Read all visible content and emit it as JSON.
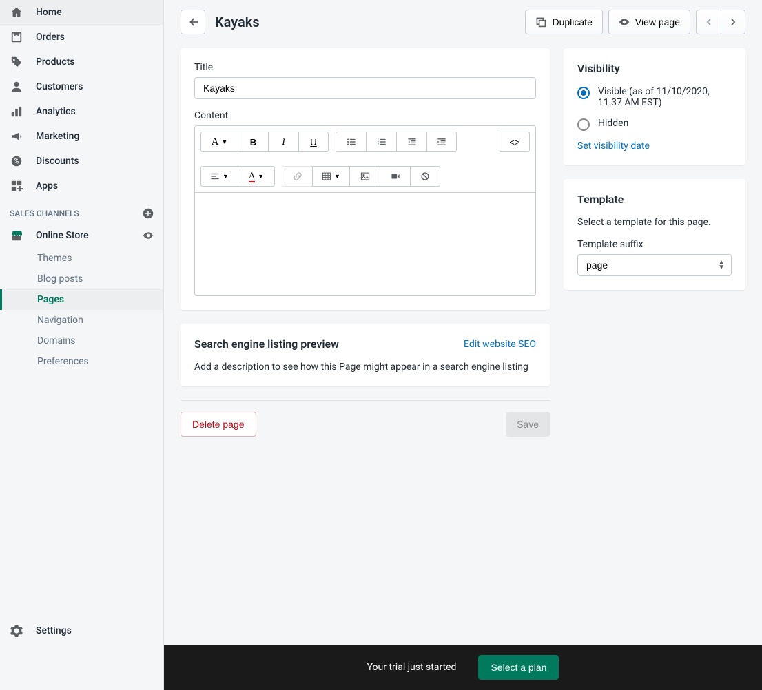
{
  "sidebar": {
    "nav": [
      {
        "label": "Home",
        "icon": "home"
      },
      {
        "label": "Orders",
        "icon": "orders"
      },
      {
        "label": "Products",
        "icon": "tag"
      },
      {
        "label": "Customers",
        "icon": "person"
      },
      {
        "label": "Analytics",
        "icon": "analytics"
      },
      {
        "label": "Marketing",
        "icon": "megaphone"
      },
      {
        "label": "Discounts",
        "icon": "discount"
      },
      {
        "label": "Apps",
        "icon": "apps"
      }
    ],
    "section_label": "SALES CHANNELS",
    "channel": {
      "label": "Online Store"
    },
    "sub_items": [
      "Themes",
      "Blog posts",
      "Pages",
      "Navigation",
      "Domains",
      "Preferences"
    ],
    "settings_label": "Settings"
  },
  "header": {
    "title": "Kayaks",
    "duplicate_label": "Duplicate",
    "view_label": "View page"
  },
  "form": {
    "title_label": "Title",
    "title_value": "Kayaks",
    "content_label": "Content"
  },
  "seo": {
    "heading": "Search engine listing preview",
    "edit_link": "Edit website SEO",
    "description": "Add a description to see how this Page might appear in a search engine listing"
  },
  "visibility": {
    "heading": "Visibility",
    "visible_label": "Visible (as of 11/10/2020, 11:37 AM EST)",
    "hidden_label": "Hidden",
    "set_date": "Set visibility date"
  },
  "template": {
    "heading": "Template",
    "subtext": "Select a template for this page.",
    "suffix_label": "Template suffix",
    "selected": "page"
  },
  "actions": {
    "delete": "Delete page",
    "save": "Save"
  },
  "trial": {
    "text": "Your trial just started",
    "button": "Select a plan"
  }
}
